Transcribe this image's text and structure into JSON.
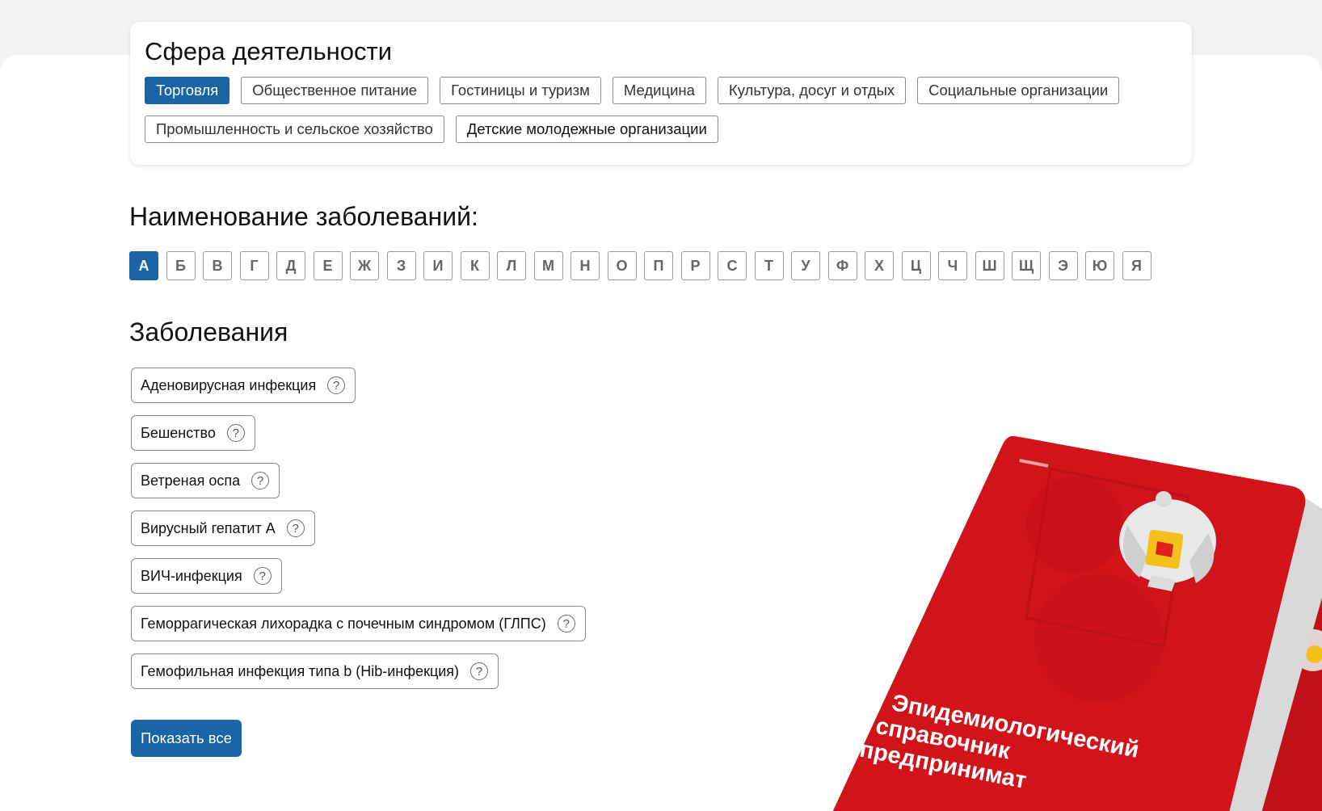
{
  "sphere": {
    "title": "Сфера деятельности",
    "items": [
      {
        "label": "Торговля",
        "active": true
      },
      {
        "label": "Общественное питание",
        "active": false
      },
      {
        "label": "Гостиницы и туризм",
        "active": false
      },
      {
        "label": "Медицина",
        "active": false
      },
      {
        "label": "Культура, досуг и отдых",
        "active": false
      },
      {
        "label": "Социальные организации",
        "active": false
      },
      {
        "label": "Промышленность и сельское хозяйство",
        "active": false
      },
      {
        "label": "Детские молодежные организации",
        "active": false
      }
    ]
  },
  "alphabet": {
    "title": "Наименование заболеваний:",
    "letters": [
      "А",
      "Б",
      "В",
      "Г",
      "Д",
      "Е",
      "Ж",
      "З",
      "И",
      "К",
      "Л",
      "М",
      "Н",
      "О",
      "П",
      "Р",
      "С",
      "Т",
      "У",
      "Ф",
      "Х",
      "Ц",
      "Ч",
      "Ш",
      "Щ",
      "Э",
      "Ю",
      "Я"
    ],
    "active": "А"
  },
  "diseases": {
    "title": "Заболевания",
    "items": [
      "Аденовирусная инфекция",
      "Бешенство",
      "Ветреная оспа",
      "Вирусный гепатит А",
      "ВИЧ-инфекция",
      "Геморрагическая лихорадка с почечным синдромом (ГЛПС)",
      "Гемофильная инфекция типа b (Hib-инфекция)"
    ],
    "help_glyph": "?",
    "show_all_label": "Показать все"
  },
  "book": {
    "title_lines": [
      "Эпидемиологический",
      "справочник",
      "предпринимат"
    ]
  },
  "colors": {
    "accent": "#1b65a6",
    "book_red": "#d1131b",
    "book_red_dark": "#b80f16"
  },
  "icons": {
    "help": "question-circle-icon",
    "emblem": "double-headed-eagle-emblem"
  }
}
